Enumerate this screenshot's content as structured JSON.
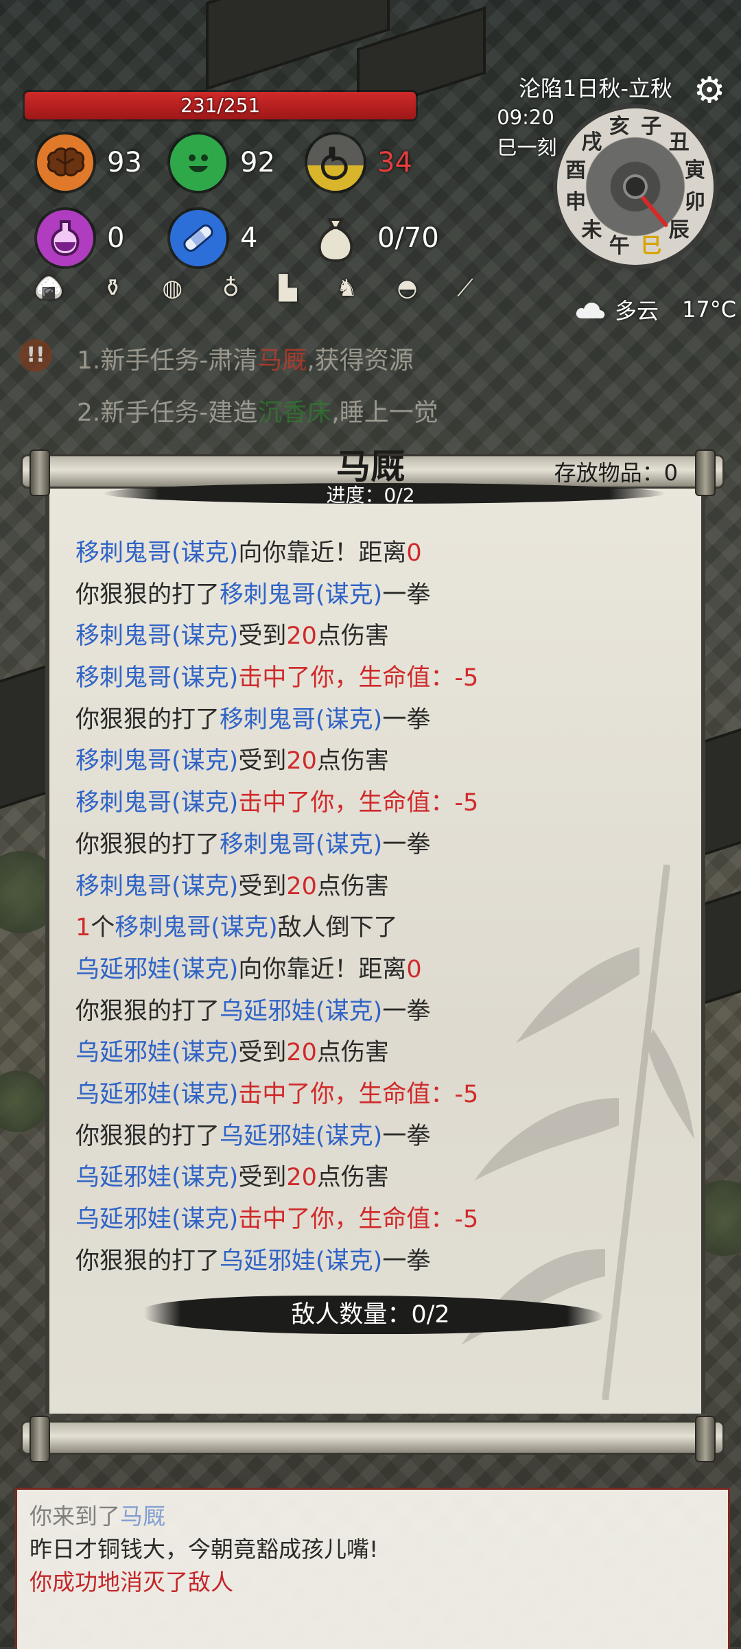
{
  "hud": {
    "hp": "231/251",
    "hp_fraction": 0.92,
    "stats": [
      {
        "name": "brain",
        "icon": "brain-icon",
        "color": "#e07a2a",
        "value": "93"
      },
      {
        "name": "mood",
        "icon": "smile-icon",
        "color": "#2fa84a",
        "value": "92"
      },
      {
        "name": "hunger",
        "icon": "stomach-icon",
        "color": "#6a6a66",
        "value": "34",
        "value_color": "#e63d3d"
      },
      {
        "name": "potion",
        "icon": "potion-icon",
        "color": "#b03cc0",
        "value": "0"
      },
      {
        "name": "bandage",
        "icon": "bandage-icon",
        "color": "#2d6fd8",
        "value": "4"
      },
      {
        "name": "bag",
        "icon": "money-bag-icon",
        "color": "#d8d2c0",
        "value": "0/70"
      }
    ],
    "inventory_icons": [
      "food-icon",
      "vase-icon",
      "cake-icon",
      "bottle-icon",
      "boot-icon",
      "horse-icon",
      "pouch-icon",
      "torch-icon"
    ]
  },
  "calendar": {
    "date": "沦陷1日秋-立秋",
    "time": "09:20",
    "ke": "巳一刻",
    "hours": [
      "子",
      "丑",
      "寅",
      "卯",
      "辰",
      "巳",
      "午",
      "未",
      "申",
      "酉",
      "戌",
      "亥"
    ],
    "active_hour": "巳",
    "weather": "多云",
    "temperature": "17°C"
  },
  "quests": [
    {
      "prefix": "1.新手任务-肃清",
      "highlight": "马厩",
      "suffix": ",获得资源",
      "highlight_color": "red"
    },
    {
      "prefix": "2.新手任务-建造",
      "highlight": "沉香床",
      "suffix": ",睡上一觉",
      "highlight_color": "green"
    }
  ],
  "panel": {
    "title": "马厩",
    "progress": "进度：0/2",
    "storage": "存放物品：0",
    "enemy_count": "敌人数量：0/2",
    "log": [
      [
        {
          "t": "移刺鬼哥(谋克)",
          "c": "b"
        },
        {
          "t": "向你靠近！距离"
        },
        {
          "t": "0",
          "c": "r"
        }
      ],
      [
        {
          "t": "你狠狠的打了"
        },
        {
          "t": "移刺鬼哥(谋克)",
          "c": "b"
        },
        {
          "t": "一拳"
        }
      ],
      [
        {
          "t": "移刺鬼哥(谋克)",
          "c": "b"
        },
        {
          "t": "受到"
        },
        {
          "t": "20",
          "c": "r"
        },
        {
          "t": "点伤害"
        }
      ],
      [
        {
          "t": "移刺鬼哥(谋克)",
          "c": "b"
        },
        {
          "t": "击中了你，生命值：-5",
          "c": "r"
        }
      ],
      [
        {
          "t": "你狠狠的打了"
        },
        {
          "t": "移刺鬼哥(谋克)",
          "c": "b"
        },
        {
          "t": "一拳"
        }
      ],
      [
        {
          "t": "移刺鬼哥(谋克)",
          "c": "b"
        },
        {
          "t": "受到"
        },
        {
          "t": "20",
          "c": "r"
        },
        {
          "t": "点伤害"
        }
      ],
      [
        {
          "t": "移刺鬼哥(谋克)",
          "c": "b"
        },
        {
          "t": "击中了你，生命值：-5",
          "c": "r"
        }
      ],
      [
        {
          "t": "你狠狠的打了"
        },
        {
          "t": "移刺鬼哥(谋克)",
          "c": "b"
        },
        {
          "t": "一拳"
        }
      ],
      [
        {
          "t": "移刺鬼哥(谋克)",
          "c": "b"
        },
        {
          "t": "受到"
        },
        {
          "t": "20",
          "c": "r"
        },
        {
          "t": "点伤害"
        }
      ],
      [
        {
          "t": "1",
          "c": "r"
        },
        {
          "t": "个"
        },
        {
          "t": "移刺鬼哥(谋克)",
          "c": "b"
        },
        {
          "t": "敌人倒下了"
        }
      ],
      [
        {
          "t": "乌延邪娃(谋克)",
          "c": "b"
        },
        {
          "t": "向你靠近！距离"
        },
        {
          "t": "0",
          "c": "r"
        }
      ],
      [
        {
          "t": "你狠狠的打了"
        },
        {
          "t": "乌延邪娃(谋克)",
          "c": "b"
        },
        {
          "t": "一拳"
        }
      ],
      [
        {
          "t": "乌延邪娃(谋克)",
          "c": "b"
        },
        {
          "t": "受到"
        },
        {
          "t": "20",
          "c": "r"
        },
        {
          "t": "点伤害"
        }
      ],
      [
        {
          "t": "乌延邪娃(谋克)",
          "c": "b"
        },
        {
          "t": "击中了你，生命值：-5",
          "c": "r"
        }
      ],
      [
        {
          "t": "你狠狠的打了"
        },
        {
          "t": "乌延邪娃(谋克)",
          "c": "b"
        },
        {
          "t": "一拳"
        }
      ],
      [
        {
          "t": "乌延邪娃(谋克)",
          "c": "b"
        },
        {
          "t": "受到"
        },
        {
          "t": "20",
          "c": "r"
        },
        {
          "t": "点伤害"
        }
      ],
      [
        {
          "t": "乌延邪娃(谋克)",
          "c": "b"
        },
        {
          "t": "击中了你，生命值：-5",
          "c": "r"
        }
      ],
      [
        {
          "t": "你狠狠的打了"
        },
        {
          "t": "乌延邪娃(谋克)",
          "c": "b"
        },
        {
          "t": "一拳"
        }
      ]
    ]
  },
  "messages": {
    "arrive_prefix": "你来到了",
    "arrive_place": "马厩",
    "poem": "昨日才铜钱大，今朝竟豁成孩儿嘴!",
    "victory": "你成功地消灭了敌人"
  }
}
